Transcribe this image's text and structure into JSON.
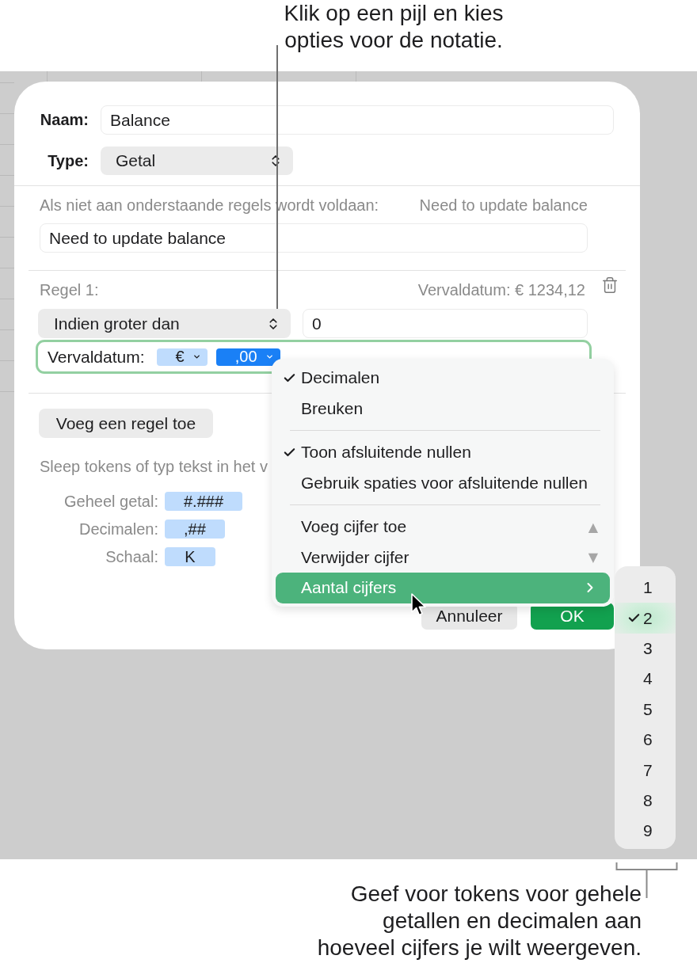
{
  "top_callout": {
    "lines": [
      "Klik op een pijl en kies",
      "opties voor de notatie."
    ]
  },
  "dialog": {
    "name": {
      "label": "Naam:",
      "value": "Balance"
    },
    "type": {
      "label": "Type:",
      "value": "Getal"
    },
    "fallback": {
      "label": "Als niet aan onderstaande regels wordt voldaan:",
      "preview": "Need to update balance",
      "value": "Need to update balance"
    },
    "rule": {
      "label": "Regel 1:",
      "preview": "Vervaldatum: € 1234,12",
      "condition": "Indien groter dan",
      "value": "0",
      "format_field": {
        "focused": true,
        "label": "Vervaldatum:",
        "tokens": [
          {
            "label": "€",
            "selected": false
          },
          {
            "label": ",00",
            "selected": true
          }
        ]
      }
    },
    "add_rule_button": "Voeg een regel toe",
    "hint": "Sleep tokens of typ tekst in het v",
    "format_tokens": [
      {
        "label": "Geheel getal:",
        "token": "#.###"
      },
      {
        "label": "Decimalen:",
        "token": ",##"
      },
      {
        "label": "Schaal:",
        "token": "K"
      }
    ],
    "buttons": [
      {
        "label": "Annuleer",
        "kind": "cancel"
      },
      {
        "label": "OK",
        "kind": "default"
      }
    ]
  },
  "format_menu": {
    "groups": [
      {
        "items": [
          {
            "kind": "option",
            "label": "Decimalen",
            "checked": true,
            "selected": false
          },
          {
            "kind": "option",
            "label": "Breuken",
            "checked": false,
            "selected": false
          }
        ]
      },
      {
        "items": [
          {
            "kind": "option",
            "label": "Toon afsluitende nullen",
            "checked": true,
            "selected": false
          },
          {
            "kind": "option",
            "label": "Gebruik spaties voor afsluitende nullen",
            "checked": false,
            "selected": false
          }
        ]
      },
      {
        "items": [
          {
            "kind": "action",
            "label": "Voeg cijfer toe",
            "key": "▲",
            "selected": false
          },
          {
            "kind": "action",
            "label": "Verwijder cijfer",
            "key": "▼",
            "selected": false
          },
          {
            "kind": "submenu",
            "label": "Aantal cijfers",
            "selected": true
          }
        ]
      }
    ]
  },
  "digits_submenu": {
    "items": [
      {
        "label": "1",
        "checked": false,
        "selected": false
      },
      {
        "label": "2",
        "checked": true,
        "selected": true
      },
      {
        "label": "3",
        "checked": false,
        "selected": false
      },
      {
        "label": "4",
        "checked": false,
        "selected": false
      },
      {
        "label": "5",
        "checked": false,
        "selected": false
      },
      {
        "label": "6",
        "checked": false,
        "selected": false
      },
      {
        "label": "7",
        "checked": false,
        "selected": false
      },
      {
        "label": "8",
        "checked": false,
        "selected": false
      },
      {
        "label": "9",
        "checked": false,
        "selected": false
      }
    ]
  },
  "bottom_callout": {
    "lines": [
      "Geef voor tokens voor gehele",
      "getallen en decimalen aan",
      "hoeveel cijfers je wilt weergeven."
    ]
  }
}
